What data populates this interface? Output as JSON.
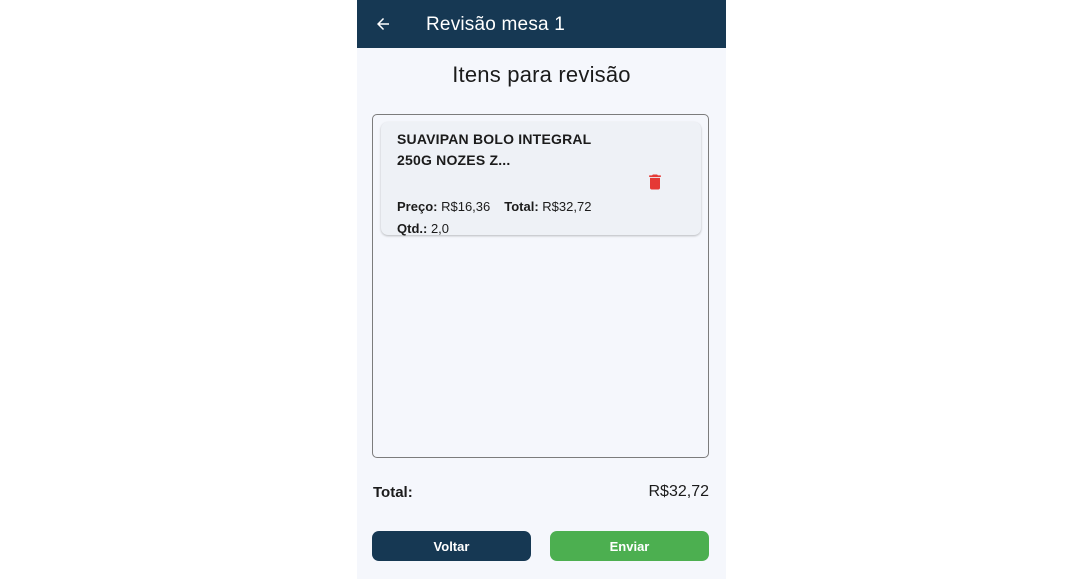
{
  "appbar": {
    "title": "Revisão mesa 1",
    "back_icon": "arrow-left-icon"
  },
  "page": {
    "heading": "Itens para revisão"
  },
  "items": [
    {
      "name": "SUAVIPAN BOLO INTEGRAL 250G NOZES Z...",
      "price_label": "Preço:",
      "price_value": "R$16,36",
      "total_label": "Total:",
      "total_value": "R$32,72",
      "qty_label": "Qtd.:",
      "qty_value": "2,0",
      "delete_icon": "trash-icon"
    }
  ],
  "summary": {
    "total_label": "Total:",
    "total_value": "R$32,72"
  },
  "actions": {
    "back_label": "Voltar",
    "send_label": "Enviar"
  },
  "colors": {
    "appbar": "#163853",
    "back_button": "#163853",
    "send_button": "#4caf50",
    "delete_icon": "#e53935",
    "background": "#f5f7fc"
  }
}
